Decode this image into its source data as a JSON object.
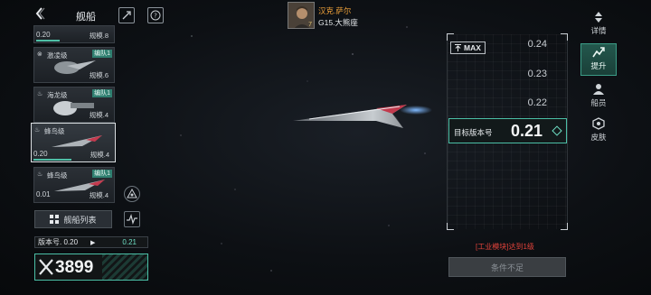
{
  "header": {
    "back_icon": "chevron-left-icon",
    "title": "舰船",
    "icon_1": "rocket-icon",
    "icon_2": "question-icon"
  },
  "commander": {
    "name": "汉克.萨尔",
    "position": "G15.大熊座",
    "level": "7"
  },
  "ships": [
    {
      "version": "0.20",
      "scale": "规模.8",
      "name": "",
      "fleet": ""
    },
    {
      "name": "激凌级",
      "fleet": "编队1",
      "scale": "规模.6",
      "version": ""
    },
    {
      "name": "海龙级",
      "fleet": "编队1",
      "scale": "规模.4",
      "version": ""
    },
    {
      "name": "蜂鸟级",
      "fleet": "",
      "version": "0.20",
      "scale": "规模.4"
    },
    {
      "name": "蜂鸟级",
      "fleet": "编队1",
      "version": "0.01",
      "scale": "规模.4"
    }
  ],
  "list_button": {
    "label": "舰船列表",
    "icon": "grid-icon"
  },
  "version_row": {
    "label": "版本号. 0.20",
    "target": "0.21"
  },
  "power": {
    "value": "3899",
    "icon": "crossed-swords-icon"
  },
  "selector": {
    "max_label": "MAX",
    "options": [
      "0.24",
      "0.23",
      "0.22"
    ],
    "target_label": "目标版本号",
    "target_value": "0.21"
  },
  "warning": "[工业模块]达到1级",
  "condition_button": "条件不足",
  "tabs": [
    {
      "label": "详情",
      "icon": "arrows-icon",
      "active": false
    },
    {
      "label": "提升",
      "icon": "upgrade-icon",
      "active": true
    },
    {
      "label": "船员",
      "icon": "crew-icon",
      "active": false
    },
    {
      "label": "皮肤",
      "icon": "skin-icon",
      "active": false
    }
  ],
  "colors": {
    "accent": "#4bbfa6",
    "warning": "#e2433b",
    "commander_name": "#f0a23a"
  }
}
